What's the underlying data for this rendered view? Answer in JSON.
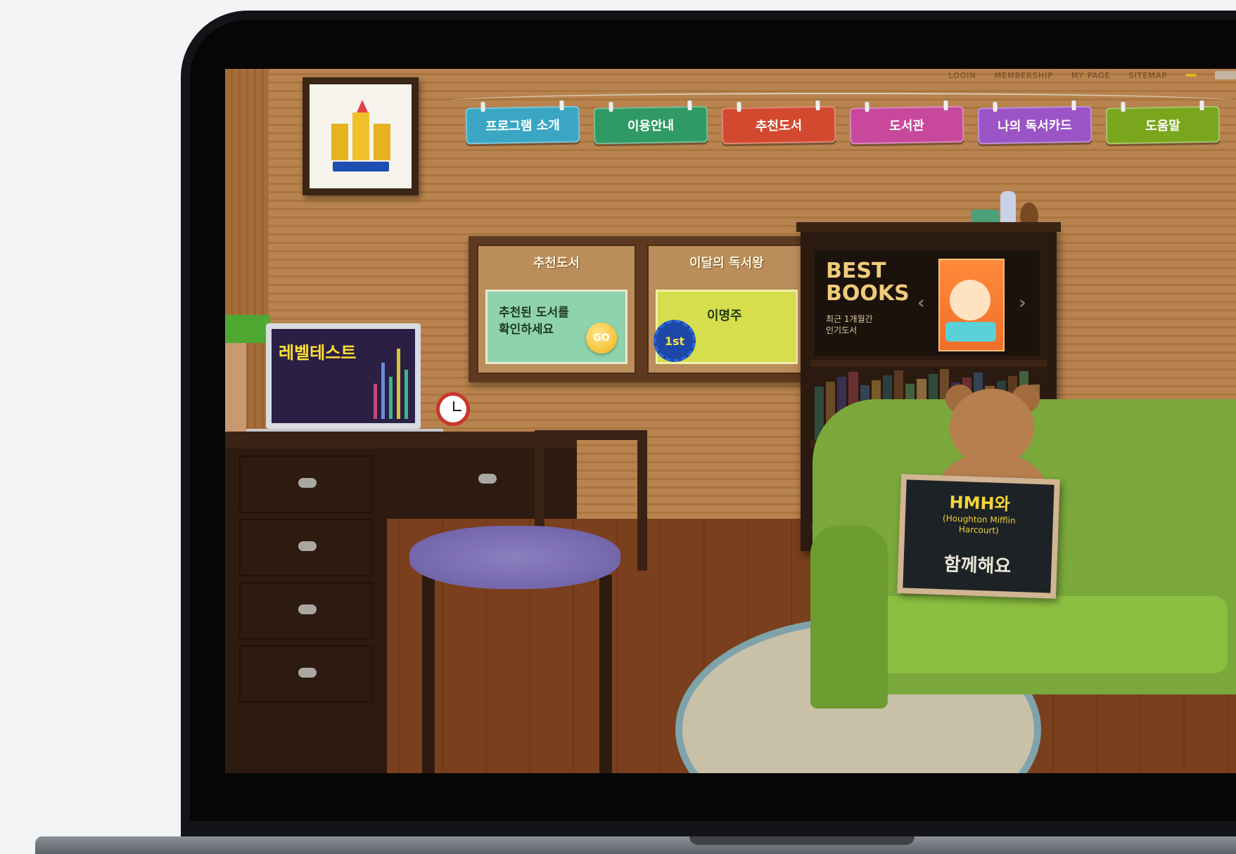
{
  "site": {
    "top_links": [
      "LOGIN",
      "MEMBERSHIP",
      "MY PAGE",
      "SITEMAP"
    ],
    "top_badge": "",
    "nav": [
      {
        "label": "프로그램 소개",
        "color": "#3aa6c4"
      },
      {
        "label": "이용안내",
        "color": "#2f9a63"
      },
      {
        "label": "추천도서",
        "color": "#d2492f"
      },
      {
        "label": "도서관",
        "color": "#c8489b"
      },
      {
        "label": "나의 독서카드",
        "color": "#9b54c6"
      },
      {
        "label": "도움말",
        "color": "#7aa61e"
      }
    ],
    "logo_text": "",
    "recommend": {
      "title": "추천도서",
      "card_text": "추천된 도서를\n확인하세요",
      "go_label": "GO"
    },
    "monthly": {
      "title": "이달의 독서왕",
      "rank": "1st",
      "name": "이명주",
      "sub": "",
      "desc": ""
    },
    "best_books": {
      "title": "BEST\nBOOKS",
      "sub": "최근 1개월간\n인기도서",
      "prev": "‹",
      "next": "›"
    },
    "level_test": {
      "title": "레벨테스트",
      "sub": ""
    },
    "chalkboard": {
      "line1": "HMH와",
      "line2": "(Houghton Mifflin\nHarcourt)",
      "line3": "함께해요"
    }
  },
  "colors": {
    "wall": "#b8834e",
    "floor": "#7a3f1d",
    "armchair": "#7aa83a",
    "chalk_yellow": "#f2d33b"
  }
}
